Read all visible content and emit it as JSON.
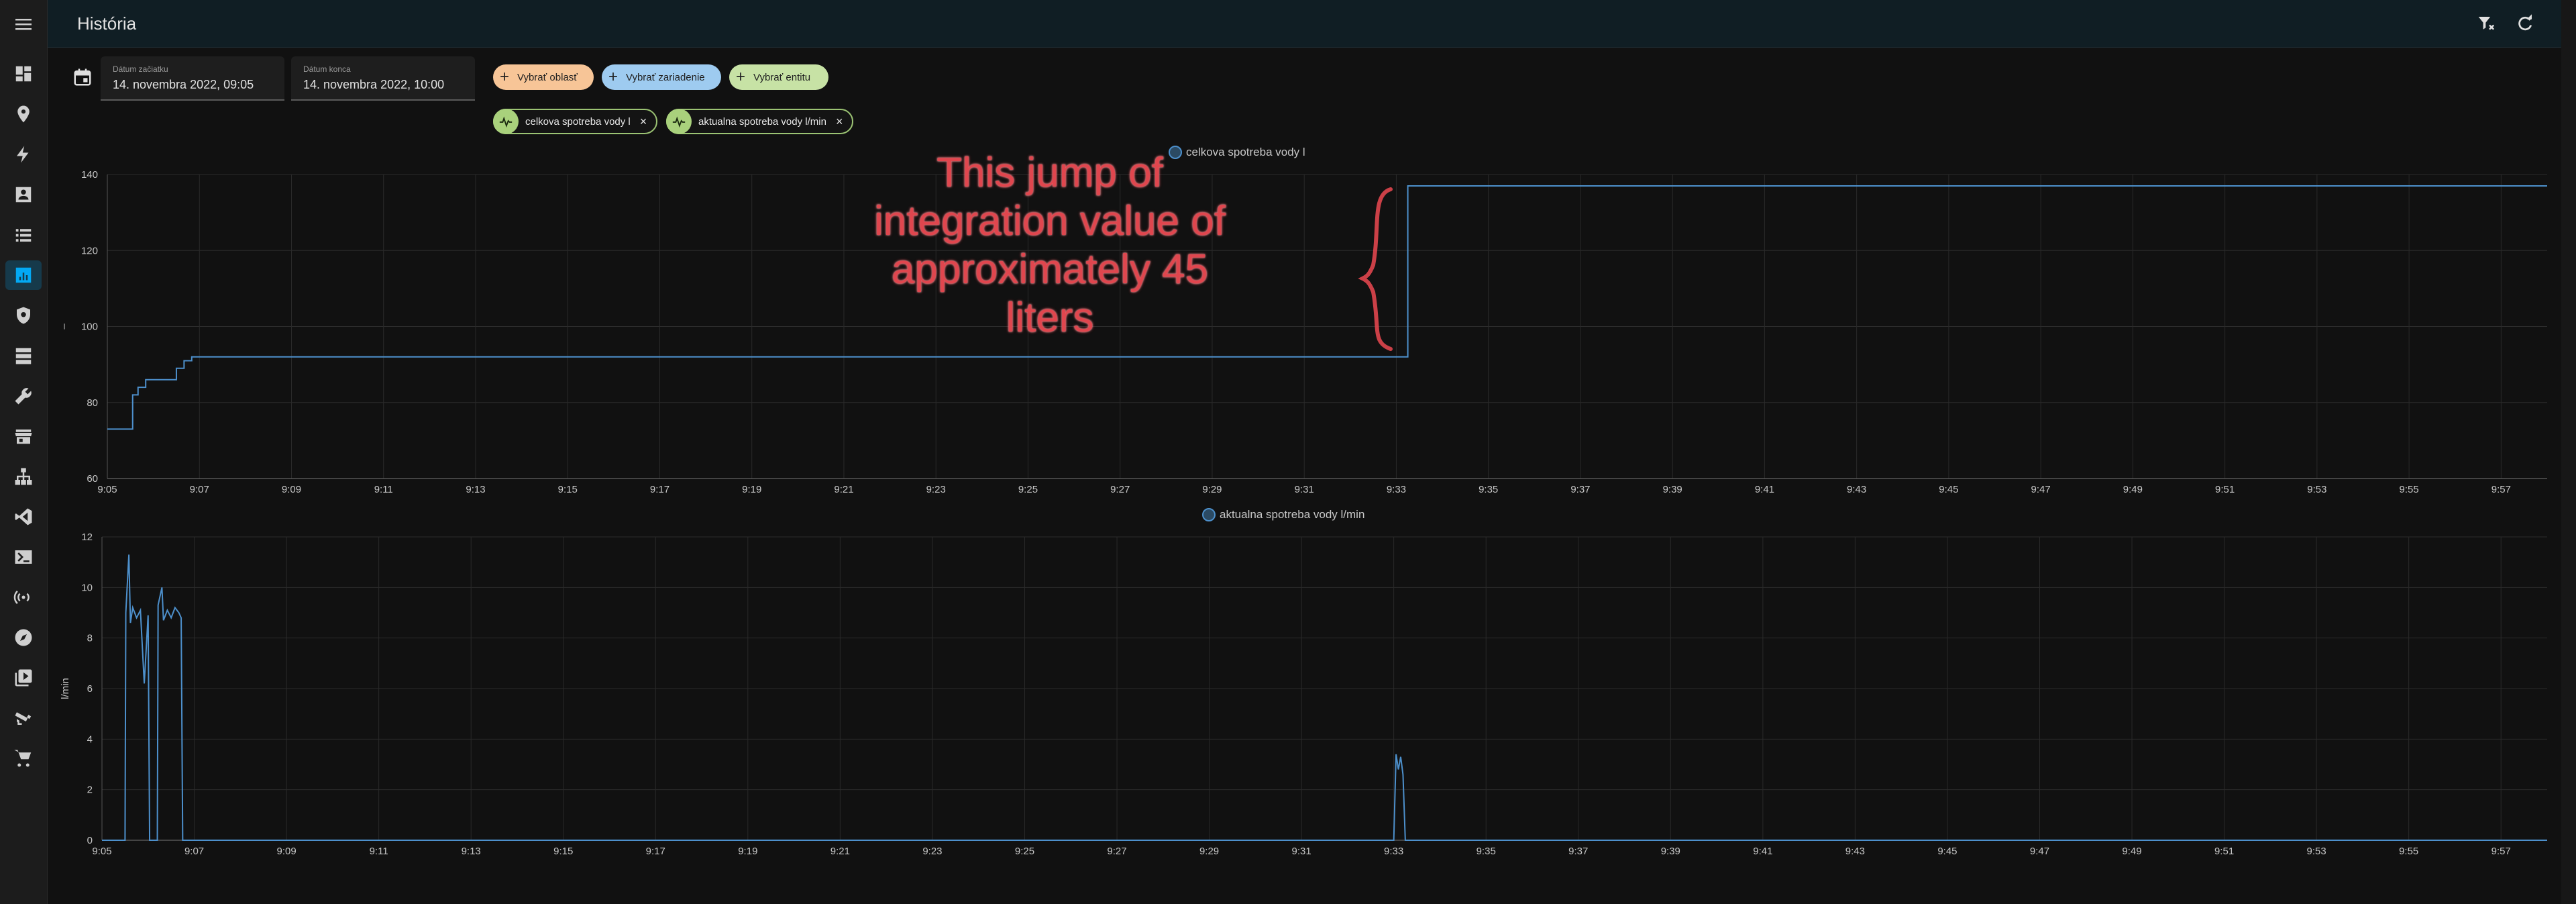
{
  "page": {
    "title": "História"
  },
  "topbar": {
    "icons": [
      "filter-remove-icon",
      "refresh-icon"
    ]
  },
  "sidebar": {
    "items": [
      {
        "name": "overview",
        "icon": "dashboard-icon",
        "active": false
      },
      {
        "name": "map",
        "icon": "map-marker-icon",
        "active": false
      },
      {
        "name": "energy",
        "icon": "lightning-icon",
        "active": false
      },
      {
        "name": "logbook",
        "icon": "account-box-icon",
        "active": false
      },
      {
        "name": "todo",
        "icon": "list-icon",
        "active": false
      },
      {
        "name": "history",
        "icon": "chart-box-icon",
        "active": true
      },
      {
        "name": "security",
        "icon": "shield-icon",
        "active": false
      },
      {
        "name": "media",
        "icon": "server-icon",
        "active": false
      },
      {
        "name": "tools",
        "icon": "wrench-icon",
        "active": false
      },
      {
        "name": "store",
        "icon": "store-icon",
        "active": false
      },
      {
        "name": "network",
        "icon": "sitemap-icon",
        "active": false
      },
      {
        "name": "vscode",
        "icon": "code-icon",
        "active": false
      },
      {
        "name": "terminal",
        "icon": "console-icon",
        "active": false
      },
      {
        "name": "wireless",
        "icon": "access-point-icon",
        "active": false
      },
      {
        "name": "explore",
        "icon": "compass-icon",
        "active": false
      },
      {
        "name": "library",
        "icon": "play-box-icon",
        "active": false
      },
      {
        "name": "camera",
        "icon": "cctv-icon",
        "active": false
      },
      {
        "name": "shop",
        "icon": "cart-icon",
        "active": false
      }
    ]
  },
  "range": {
    "start_label": "Dátum začiatku",
    "start_value": "14. novembra 2022, 09:05",
    "end_label": "Dátum konca",
    "end_value": "14. novembra 2022, 10:00"
  },
  "target": {
    "area_label": "Vybrať oblasť",
    "device_label": "Vybrať zariadenie",
    "entity_label": "Vybrať entitu",
    "colors": {
      "area": "#f7c597",
      "device": "#9ecbf0",
      "entity": "#c7e2a5"
    }
  },
  "chips": [
    {
      "label": "celkova spotreba vody l"
    },
    {
      "label": "aktualna spotreba vody l/min"
    }
  ],
  "annotation": {
    "lines": [
      "This jump of",
      "integration value of",
      "approximately 45",
      "liters"
    ]
  },
  "chart_data": [
    {
      "type": "line",
      "step": true,
      "title": "",
      "xlabel": "",
      "ylabel": "",
      "ylim": [
        60,
        140
      ],
      "yticks": [
        60,
        80,
        100,
        120,
        140
      ],
      "xlim": [
        "9:05",
        "9:58"
      ],
      "xticks": [
        "9:05",
        "9:07",
        "9:09",
        "9:11",
        "9:13",
        "9:15",
        "9:17",
        "9:19",
        "9:21",
        "9:23",
        "9:25",
        "9:27",
        "9:29",
        "9:31",
        "9:33",
        "9:35",
        "9:37",
        "9:39",
        "9:41",
        "9:43",
        "9:45",
        "9:47",
        "9:49",
        "9:51",
        "9:53",
        "9:55",
        "9:57"
      ],
      "grid": true,
      "legend": "top-center",
      "color": "#4d90cc",
      "series": [
        {
          "name": "celkova spotreba vody l",
          "x": [
            "9:05:00",
            "9:05:33",
            "9:05:40",
            "9:05:50",
            "9:06:20",
            "9:06:30",
            "9:06:40",
            "9:06:50",
            "9:33:15",
            "9:58:00"
          ],
          "values": [
            73,
            82,
            84,
            86,
            86,
            89,
            91,
            92,
            137,
            137
          ]
        }
      ]
    },
    {
      "type": "line",
      "title": "",
      "xlabel": "",
      "ylabel": "l/min",
      "ylim": [
        0,
        12
      ],
      "yticks": [
        0,
        2,
        4,
        6,
        8,
        10,
        12
      ],
      "xlim": [
        "9:05",
        "9:58"
      ],
      "xticks": [
        "9:05",
        "9:07",
        "9:09",
        "9:11",
        "9:13",
        "9:15",
        "9:17",
        "9:19",
        "9:21",
        "9:23",
        "9:25",
        "9:27",
        "9:29",
        "9:31",
        "9:33",
        "9:35",
        "9:37",
        "9:39",
        "9:41",
        "9:43",
        "9:45",
        "9:47",
        "9:49",
        "9:51",
        "9:53",
        "9:55",
        "9:57"
      ],
      "grid": true,
      "legend": "top-center",
      "color": "#4d90cc",
      "series": [
        {
          "name": "aktualna spotreba vody l/min",
          "x": [
            "9:05:00",
            "9:05:30",
            "9:05:31",
            "9:05:35",
            "9:05:37",
            "9:05:40",
            "9:05:45",
            "9:05:50",
            "9:05:55",
            "9:06:00",
            "9:06:02",
            "9:06:05",
            "9:06:12",
            "9:06:13",
            "9:06:18",
            "9:06:20",
            "9:06:25",
            "9:06:30",
            "9:06:35",
            "9:06:40",
            "9:06:43",
            "9:06:45",
            "9:33:00",
            "9:33:03",
            "9:33:06",
            "9:33:09",
            "9:33:12",
            "9:33:15",
            "9:58:00"
          ],
          "values": [
            0,
            0,
            9,
            11.3,
            8.6,
            9.2,
            8.8,
            9.1,
            6.2,
            8.9,
            0,
            0,
            0,
            9.3,
            10,
            8.7,
            9.1,
            8.8,
            9.2,
            9.0,
            8.8,
            0,
            0,
            3.4,
            2.8,
            3.3,
            2.6,
            0,
            0
          ]
        }
      ]
    }
  ]
}
